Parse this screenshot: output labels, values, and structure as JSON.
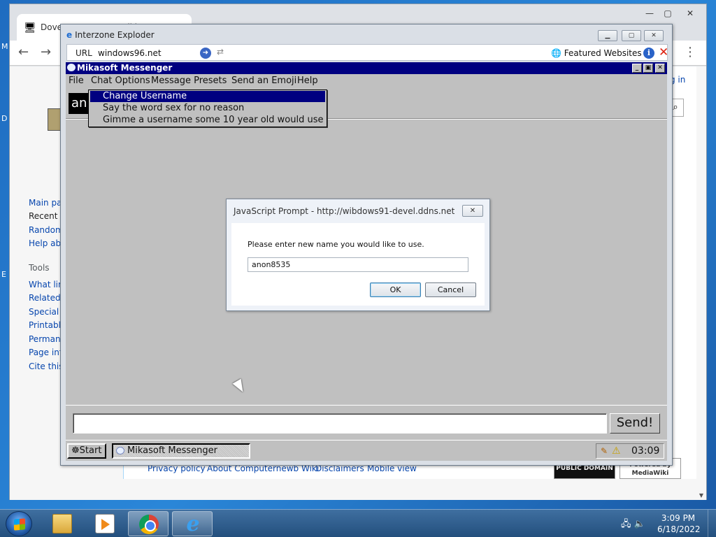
{
  "chrome": {
    "tab_title": "Dove Computers - Wiki",
    "min": "—",
    "max": "▢",
    "close": "✕",
    "back": "←",
    "forward": "→",
    "menu": "⋮",
    "side_right_text": "g in"
  },
  "wiki": {
    "sidebar": [
      "Main pag",
      "Recent c",
      "Random",
      "Help abo"
    ],
    "tools_header": "Tools",
    "tools": [
      "What link",
      "Related",
      "Special p",
      "Printable",
      "Permane",
      "Page inf",
      "Cite this"
    ],
    "footer": [
      "Privacy policy",
      "About Computernewb Wiki",
      "Disclaimers",
      "Mobile view"
    ],
    "badge_pd": "PUBLIC DOMAIN",
    "badge_mw": "Powered by MediaWiki"
  },
  "desktop": {
    "edge_labels": [
      "M",
      "D",
      "E"
    ]
  },
  "interzone": {
    "title": "Interzone Exploder",
    "url_label": "URL",
    "url": "windows96.net",
    "featured": "Featured Websites"
  },
  "messenger": {
    "title": "Mikasoft Messenger",
    "menus": [
      {
        "label": "File"
      },
      {
        "label": "Chat Options"
      },
      {
        "label": "Message Presets"
      },
      {
        "label": "Send an Emoji"
      },
      {
        "label": "Help"
      }
    ],
    "username_badge": "an",
    "dropdown": [
      "Change Username",
      "Say the word sex for no reason",
      "Gimme a username some 10 year old would use"
    ],
    "message_value": "",
    "send_label": "Send!",
    "start_label": "Start",
    "task_label": "Mikasoft Messenger",
    "clock": "03:09"
  },
  "prompt": {
    "title": "JavaScript Prompt - http://wibdows91-devel.ddns.net",
    "message": "Please enter new name you would like to use.",
    "value": "anon8535",
    "ok": "OK",
    "cancel": "Cancel"
  },
  "taskbar": {
    "time": "3:09 PM",
    "date": "6/18/2022",
    "pinned": [
      "folder-icon",
      "media-player-icon",
      "chrome-icon",
      "internet-explorer-icon"
    ]
  }
}
